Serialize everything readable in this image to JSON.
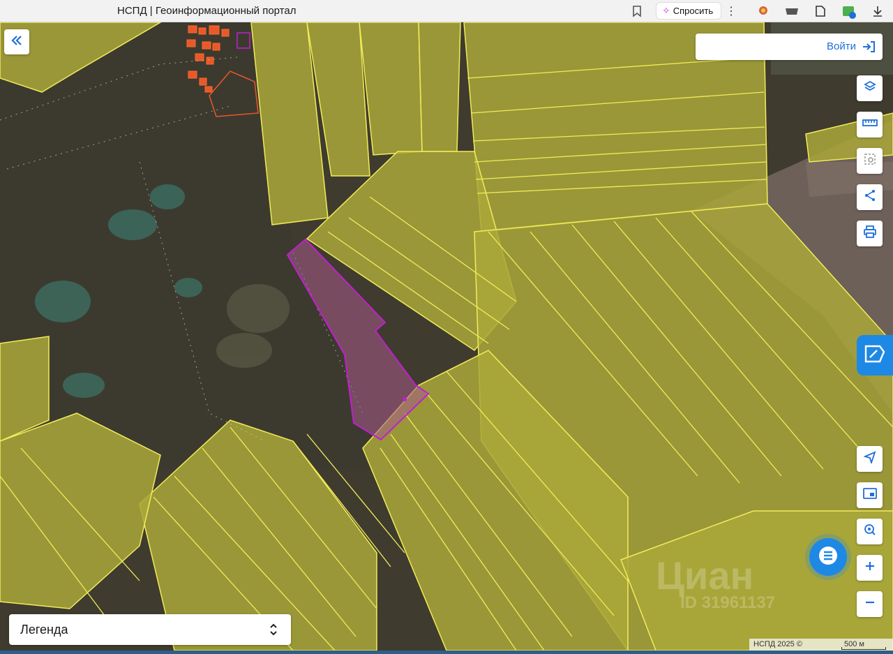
{
  "browser": {
    "tab_title": "НСПД | Геоинформационный портал",
    "ask_label": "Спросить"
  },
  "map": {
    "login_label": "Войти",
    "legend_label": "Легенда",
    "attribution": "НСПД 2025 ©",
    "scale_label": "500 м",
    "watermark": "Циан",
    "watermark_id": "ID 31961137",
    "tools": [
      "layers-icon",
      "ruler-icon",
      "select-area-icon",
      "share-icon",
      "print-icon",
      "geolocation-icon",
      "minimap-icon",
      "search-location-icon",
      "zoom-in-icon",
      "zoom-out-icon"
    ]
  },
  "colors": {
    "parcel_fill": "#b8b63a",
    "parcel_stroke": "#f1ec5a",
    "selected_parcel": "#c01fd0",
    "settlement": "#e9582a",
    "accent": "#1e88e5"
  }
}
